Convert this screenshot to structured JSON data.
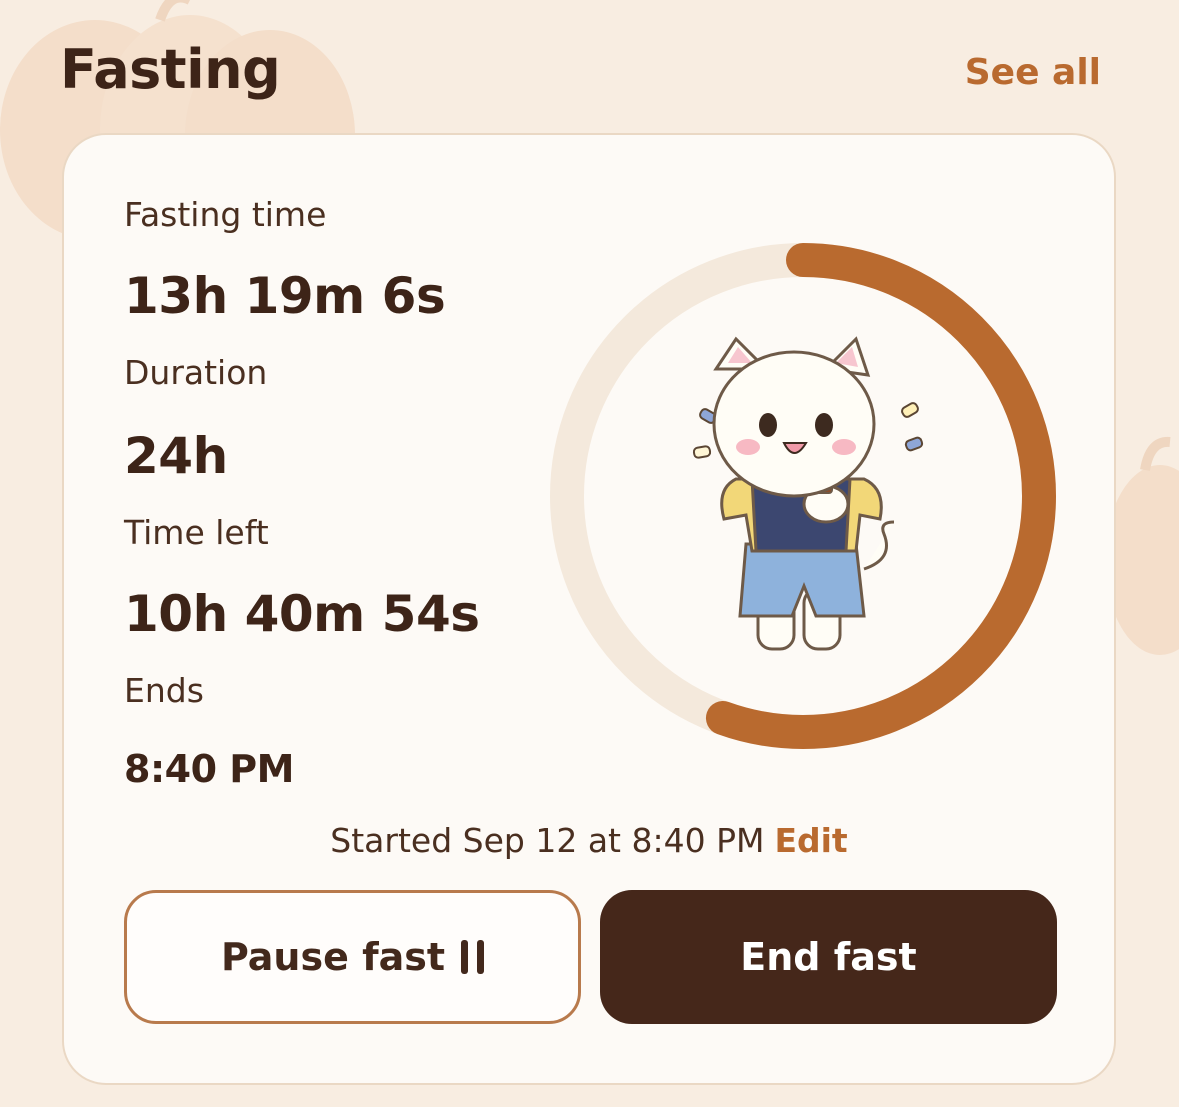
{
  "header": {
    "title": "Fasting",
    "see_all_label": "See all"
  },
  "stats": {
    "fasting_time_label": "Fasting time",
    "fasting_time_value": "13h 19m 6s",
    "duration_label": "Duration",
    "duration_value": "24h",
    "time_left_label": "Time left",
    "time_left_value": "10h 40m 54s",
    "ends_label": "Ends",
    "ends_value": "8:40 PM"
  },
  "progress": {
    "fraction": 0.555,
    "track_color": "#f4e9dc",
    "fill_color": "#b96a2f"
  },
  "mascot": {
    "icon": "cat-with-watch-icon"
  },
  "started": {
    "text": "Started Sep 12 at 8:40 PM",
    "edit_label": "Edit"
  },
  "buttons": {
    "pause_label": "Pause fast",
    "pause_icon": "pause-icon",
    "end_label": "End fast"
  },
  "colors": {
    "accent": "#b96a2f",
    "dark": "#45271a",
    "background": "#f8ede1",
    "card": "#fdfaf6"
  }
}
